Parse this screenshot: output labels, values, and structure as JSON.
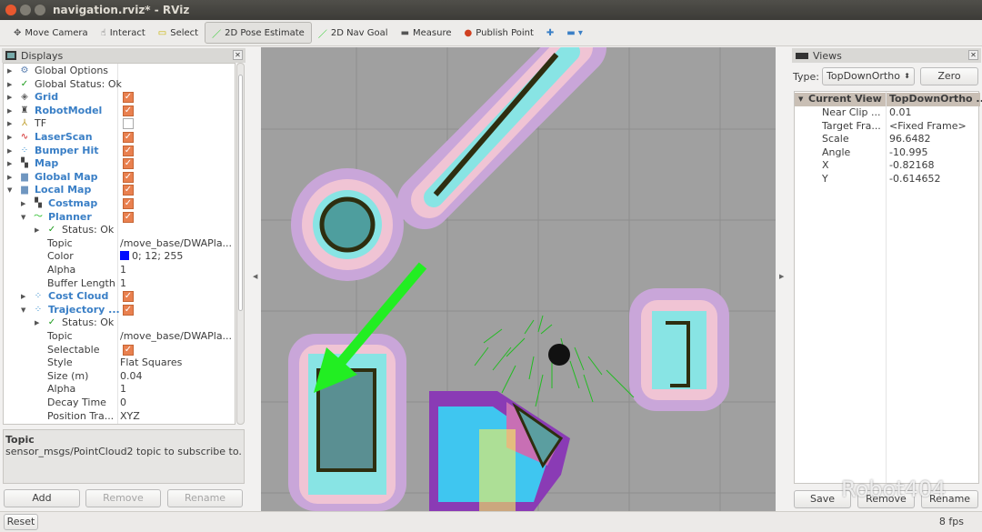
{
  "window": {
    "title": "navigation.rviz* - RViz"
  },
  "toolbar": [
    {
      "label": "Move Camera",
      "icon": "move-camera-icon"
    },
    {
      "label": "Interact",
      "icon": "hand-icon"
    },
    {
      "label": "Select",
      "icon": "select-icon"
    },
    {
      "label": "2D Pose Estimate",
      "icon": "green-arrow-icon",
      "active": true
    },
    {
      "label": "2D Nav Goal",
      "icon": "green-arrow-icon"
    },
    {
      "label": "Measure",
      "icon": "ruler-icon"
    },
    {
      "label": "Publish Point",
      "icon": "map-pin-icon"
    }
  ],
  "displays": {
    "title": "Displays",
    "rows": [
      {
        "indent": 0,
        "arrow": "▶",
        "icon": "gear-icon",
        "label": "Global Options",
        "style": "normal"
      },
      {
        "indent": 0,
        "arrow": "▶",
        "icon": "check-icon",
        "label": "Global Status: Ok",
        "style": "normal"
      },
      {
        "indent": 0,
        "arrow": "▶",
        "icon": "grid-icon",
        "label": "Grid",
        "style": "blue",
        "check": true
      },
      {
        "indent": 0,
        "arrow": "▶",
        "icon": "robot-icon",
        "label": "RobotModel",
        "style": "blue",
        "check": true
      },
      {
        "indent": 0,
        "arrow": "▶",
        "icon": "axes-icon",
        "label": "TF",
        "style": "normal",
        "check": false
      },
      {
        "indent": 0,
        "arrow": "▶",
        "icon": "laser-icon",
        "label": "LaserScan",
        "style": "blue",
        "check": true
      },
      {
        "indent": 0,
        "arrow": "▶",
        "icon": "pointcloud-icon",
        "label": "Bumper Hit",
        "style": "blue",
        "check": true
      },
      {
        "indent": 0,
        "arrow": "▶",
        "icon": "map-icon",
        "label": "Map",
        "style": "blue",
        "check": true
      },
      {
        "indent": 0,
        "arrow": "▶",
        "icon": "folder-icon",
        "label": "Global Map",
        "style": "blue",
        "check": true
      },
      {
        "indent": 0,
        "arrow": "▼",
        "icon": "folder-icon",
        "label": "Local Map",
        "style": "blue",
        "check": true
      },
      {
        "indent": 1,
        "arrow": "▶",
        "icon": "map-icon",
        "label": "Costmap",
        "style": "blue",
        "check": true
      },
      {
        "indent": 1,
        "arrow": "▼",
        "icon": "path-icon",
        "label": "Planner",
        "style": "blue",
        "check": true
      },
      {
        "indent": 2,
        "arrow": "▶",
        "icon": "check-icon",
        "label": "Status: Ok",
        "style": "normal"
      },
      {
        "indent": 3,
        "label": "Topic",
        "value": "/move_base/DWAPla..."
      },
      {
        "indent": 3,
        "label": "Color",
        "value": "0; 12; 255",
        "swatch": "#000cff"
      },
      {
        "indent": 3,
        "label": "Alpha",
        "value": "1"
      },
      {
        "indent": 3,
        "label": "Buffer Length",
        "value": "1"
      },
      {
        "indent": 1,
        "arrow": "▶",
        "icon": "pointcloud-icon",
        "label": "Cost Cloud",
        "style": "blue",
        "check": true
      },
      {
        "indent": 1,
        "arrow": "▼",
        "icon": "pointcloud-icon",
        "label": "Trajectory ...",
        "style": "blue",
        "check": true
      },
      {
        "indent": 2,
        "arrow": "▶",
        "icon": "check-icon",
        "label": "Status: Ok",
        "style": "normal"
      },
      {
        "indent": 3,
        "label": "Topic",
        "value": "/move_base/DWAPla..."
      },
      {
        "indent": 3,
        "label": "Selectable",
        "check": true
      },
      {
        "indent": 3,
        "label": "Style",
        "value": "Flat Squares"
      },
      {
        "indent": 3,
        "label": "Size (m)",
        "value": "0.04"
      },
      {
        "indent": 3,
        "label": "Alpha",
        "value": "1"
      },
      {
        "indent": 3,
        "label": "Decay Time",
        "value": "0"
      },
      {
        "indent": 3,
        "label": "Position Tra...",
        "value": "XYZ"
      }
    ],
    "description_title": "Topic",
    "description_text": "sensor_msgs/PointCloud2 topic to subscribe to.",
    "add": "Add",
    "remove": "Remove",
    "rename": "Rename"
  },
  "views": {
    "title": "Views",
    "type_label": "Type:",
    "type_value": "TopDownOrtho",
    "zero": "Zero",
    "header_key": "Current View",
    "header_value": "TopDownOrtho ...",
    "rows": [
      {
        "k": "Near Clip ...",
        "v": "0.01"
      },
      {
        "k": "Target Fra...",
        "v": "<Fixed Frame>"
      },
      {
        "k": "Scale",
        "v": "96.6482"
      },
      {
        "k": "Angle",
        "v": "-10.995"
      },
      {
        "k": "X",
        "v": "-0.82168"
      },
      {
        "k": "Y",
        "v": "-0.614652"
      }
    ],
    "save": "Save",
    "remove": "Remove",
    "rename": "Rename"
  },
  "status": {
    "reset": "Reset",
    "fps": "8 fps"
  },
  "watermark": "Robot404",
  "colors": {
    "checkbox": "#e9804f",
    "accent_blue": "#3a7fc6",
    "pose_arrow": "#22ee22"
  }
}
